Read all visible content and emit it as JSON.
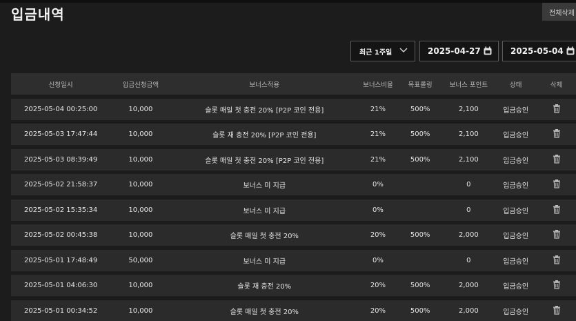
{
  "page": {
    "title": "입금내역",
    "delete_all_label": "전체삭제"
  },
  "filters": {
    "period": "최근 1주일",
    "date_from": "2025-04-27",
    "date_to": "2025-05-04"
  },
  "table": {
    "headers": [
      "신청일시",
      "입금신청금액",
      "보너스적용",
      "보너스비율",
      "목표롤링",
      "보너스 포인트",
      "상태",
      "삭제"
    ],
    "rows": [
      {
        "datetime": "2025-05-04 00:25:00",
        "amount": "10,000",
        "bonus": "슬롯 매일 첫 충전 20% [P2P 코인 전용]",
        "ratio": "21%",
        "rolling": "500%",
        "points": "2,100",
        "status": "입금승인"
      },
      {
        "datetime": "2025-05-03 17:47:44",
        "amount": "10,000",
        "bonus": "슬롯 재 충전 20% [P2P 코인 전용]",
        "ratio": "21%",
        "rolling": "500%",
        "points": "2,100",
        "status": "입금승인"
      },
      {
        "datetime": "2025-05-03 08:39:49",
        "amount": "10,000",
        "bonus": "슬롯 매일 첫 충전 20% [P2P 코인 전용]",
        "ratio": "21%",
        "rolling": "500%",
        "points": "2,100",
        "status": "입금승인"
      },
      {
        "datetime": "2025-05-02 21:58:37",
        "amount": "10,000",
        "bonus": "보너스 미 지급",
        "ratio": "0%",
        "rolling": "",
        "points": "0",
        "status": "입금승인"
      },
      {
        "datetime": "2025-05-02 15:35:34",
        "amount": "10,000",
        "bonus": "보너스 미 지급",
        "ratio": "0%",
        "rolling": "",
        "points": "0",
        "status": "입금승인"
      },
      {
        "datetime": "2025-05-02 00:45:38",
        "amount": "10,000",
        "bonus": "슬롯 매일 첫 충전 20%",
        "ratio": "20%",
        "rolling": "500%",
        "points": "2,000",
        "status": "입금승인"
      },
      {
        "datetime": "2025-05-01 17:48:49",
        "amount": "50,000",
        "bonus": "보너스 미 지급",
        "ratio": "0%",
        "rolling": "",
        "points": "0",
        "status": "입금승인"
      },
      {
        "datetime": "2025-05-01 04:06:30",
        "amount": "10,000",
        "bonus": "슬롯 재 충전 20%",
        "ratio": "20%",
        "rolling": "500%",
        "points": "2,000",
        "status": "입금승인"
      },
      {
        "datetime": "2025-05-01 00:34:52",
        "amount": "10,000",
        "bonus": "슬롯 매일 첫 충전 20%",
        "ratio": "20%",
        "rolling": "500%",
        "points": "2,000",
        "status": "입금승인"
      }
    ]
  }
}
